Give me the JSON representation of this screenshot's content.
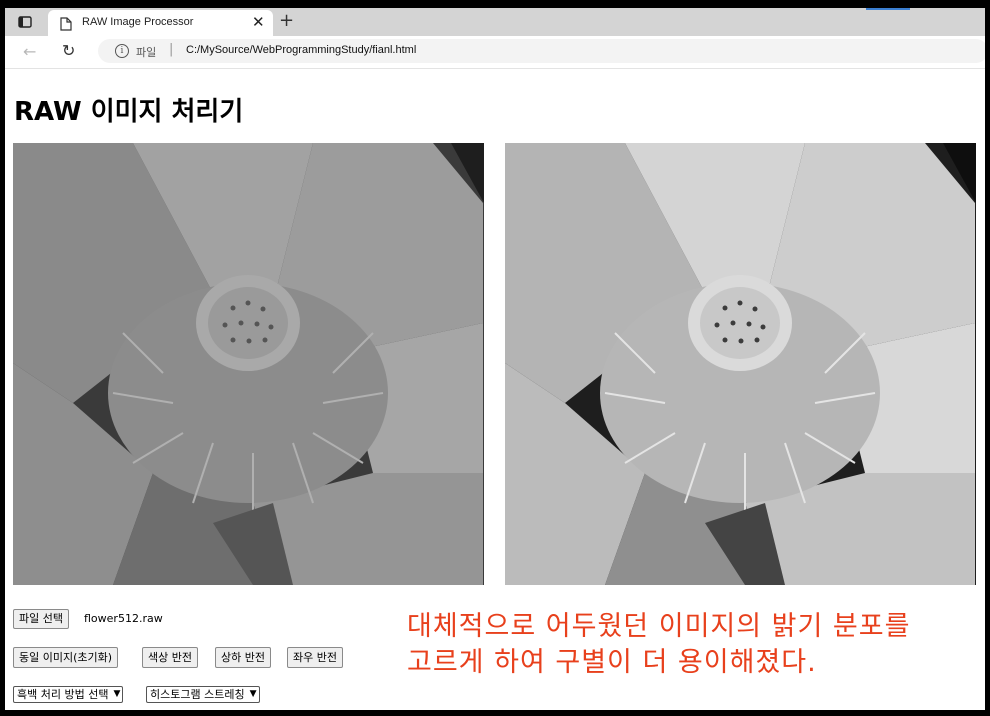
{
  "browser": {
    "tab_title": "RAW Image Processor",
    "address_scheme": "파일",
    "address_url": "C:/MySource/WebProgrammingStudy/fianl.html",
    "icons": [
      "sidebar-icon",
      "page-icon",
      "close-icon",
      "new-tab-icon",
      "back-icon",
      "reload-icon",
      "info-icon"
    ]
  },
  "page": {
    "title": "RAW 이미지 처리기",
    "file_button": "파일 선택",
    "file_name": "flower512.raw",
    "buttons": [
      "동일 이미지(초기화)",
      "색상 반전",
      "상하 반전",
      "좌우 반전"
    ],
    "select_mode": "흑백 처리 방법 선택",
    "select_hist": "히스토그램 스트레칭",
    "note_line1": "대체적으로 어두웠던 이미지의 밝기 분포를",
    "note_line2": "고르게 하여 구별이 더 용이해졌다."
  },
  "colors": {
    "note": "#e8401c"
  }
}
